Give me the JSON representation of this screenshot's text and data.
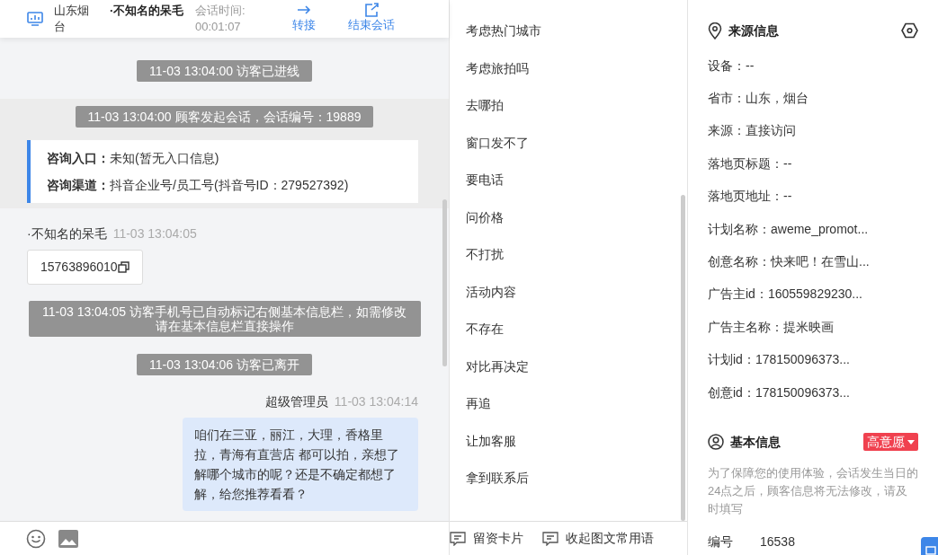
{
  "header": {
    "location": "山东烟台",
    "visitor": "·不知名的呆毛",
    "duration_label": "会话时间:",
    "duration": "00:01:07",
    "actions": [
      {
        "label": "转接",
        "kind": "transfer"
      },
      {
        "label": "结束会话",
        "kind": "end"
      }
    ]
  },
  "chat": {
    "messages": [
      {
        "kind": "system",
        "text": "11-03 13:04:00 访客已进线"
      },
      {
        "kind": "system_block",
        "text": "11-03 13:04:00 顾客发起会话，会话编号：19889",
        "details": [
          {
            "label": "咨询入口：",
            "value": "未知(暂无入口信息)"
          },
          {
            "label": "咨询渠道：",
            "value": "抖音企业号/员工号(抖音号ID：279527392)"
          }
        ]
      },
      {
        "kind": "visitor",
        "sender": "·不知名的呆毛",
        "time": "11-03 13:04:05",
        "text": "15763896010"
      },
      {
        "kind": "system",
        "text": "11-03 13:04:05 访客手机号已自动标记右侧基本信息栏，如需修改请在基本信息栏直接操作"
      },
      {
        "kind": "system",
        "text": "11-03 13:04:06 访客已离开"
      },
      {
        "kind": "agent",
        "sender": "超级管理员",
        "time": "11-03 13:04:14",
        "text": "咱们在三亚，丽江，大理，香格里拉，青海有直营店 都可以拍，亲想了解哪个城市的呢？还是不确定都想了解，给您推荐看看？"
      }
    ]
  },
  "quick_replies": {
    "items": [
      "考虑热门城市",
      "考虑旅拍吗",
      "去哪拍",
      "窗口发不了",
      "要电话",
      "问价格",
      "不打扰",
      "活动内容",
      "不存在",
      "对比再决定",
      "再追",
      "让加客服",
      "拿到联系后"
    ],
    "buttons": [
      {
        "label": "留资卡片"
      },
      {
        "label": "收起图文常用语"
      }
    ]
  },
  "source_info": {
    "title": "来源信息",
    "fields": [
      "设备：--",
      "省市：山东，烟台",
      "来源：直接访问",
      "落地页标题：--",
      "落地页地址：--",
      "计划名称：aweme_promot...",
      "创意名称：快来吧！在雪山...",
      "广告主id：160559829230...",
      "广告主名称：提米映画",
      "计划id：178150096373...",
      "创意id：178150096373..."
    ]
  },
  "basic_info": {
    "title": "基本信息",
    "intent_tag": "高意愿",
    "note": "为了保障您的使用体验，会话发生当日的24点之后，顾客信息将无法修改，请及时填写",
    "fields": [
      {
        "label": "编号",
        "value": "16538"
      }
    ]
  }
}
